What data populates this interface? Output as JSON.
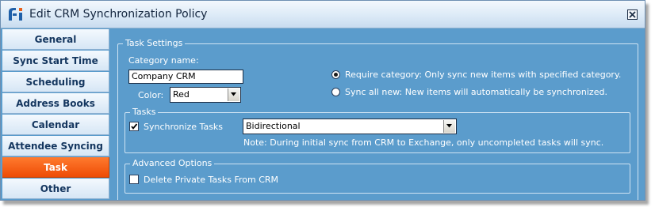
{
  "window": {
    "title": "Edit CRM Synchronization Policy"
  },
  "sidebar": {
    "items": [
      {
        "label": "General"
      },
      {
        "label": "Sync Start Time"
      },
      {
        "label": "Scheduling"
      },
      {
        "label": "Address Books"
      },
      {
        "label": "Calendar"
      },
      {
        "label": "Attendee Syncing"
      },
      {
        "label": "Task"
      },
      {
        "label": "Other"
      }
    ],
    "active_item": "Task"
  },
  "task_settings": {
    "legend": "Task Settings",
    "category_name_label": "Category name:",
    "category_name_value": "Company CRM",
    "color_label": "Color:",
    "color_value": "Red",
    "require_category_label": "Require category: Only sync new items with specified category.",
    "require_category_selected": true,
    "sync_all_new_label": "Sync all new: New items will automatically be synchronized.",
    "sync_all_new_selected": false
  },
  "tasks": {
    "legend": "Tasks",
    "synchronize_label": "Synchronize Tasks",
    "synchronize_checked": true,
    "direction_value": "Bidirectional",
    "note": "Note: During initial sync from CRM to Exchange, only uncompleted tasks will sync."
  },
  "advanced": {
    "legend": "Advanced Options",
    "delete_private_label": "Delete Private Tasks From CRM",
    "delete_private_checked": false
  },
  "colors": {
    "window_bg": "#5b9ccc",
    "active_tab": "#f05a14",
    "nav_text": "#14365f",
    "label_text": "#ffffff"
  }
}
